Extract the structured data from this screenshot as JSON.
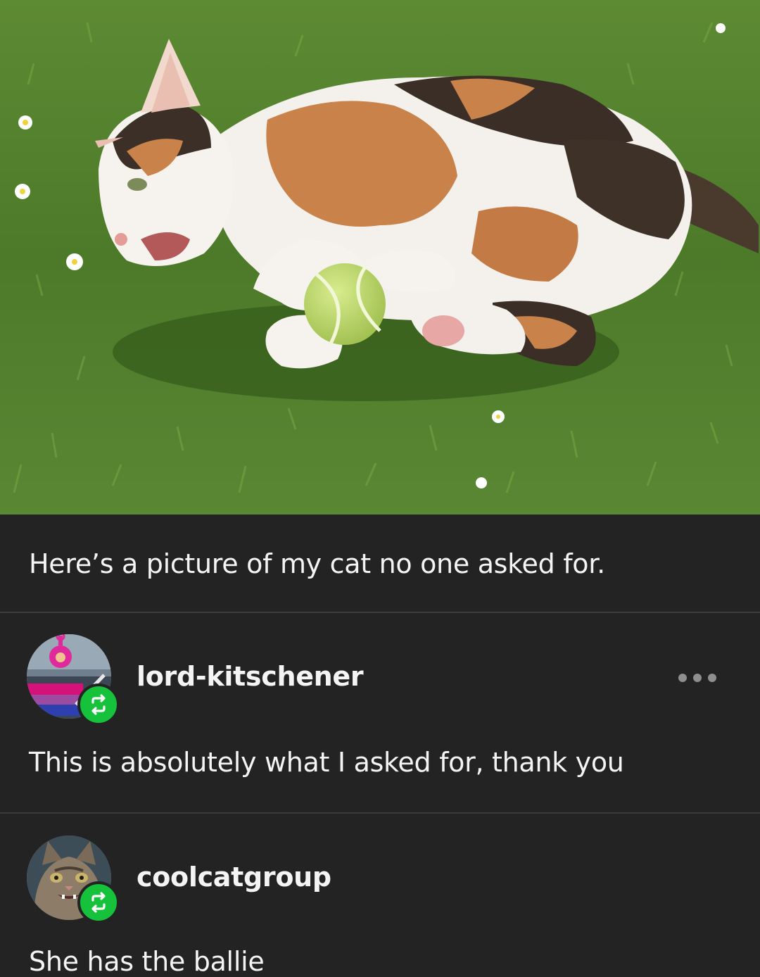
{
  "post": {
    "photo_icon": "cat-photo",
    "caption": "Here’s a picture of my cat no one asked for."
  },
  "reblogs": [
    {
      "username": "lord-kitschener",
      "avatar_icon": "teletubby-avatar",
      "badge_icon": "reblog-icon",
      "badge_color": "#16c13b",
      "more_icon": "more-options-icon",
      "text": "This is absolutely what I asked for, thank you"
    },
    {
      "username": "coolcatgroup",
      "avatar_icon": "cat-avatar",
      "badge_icon": "reblog-icon",
      "badge_color": "#16c13b",
      "text": "She has the ballie"
    }
  ]
}
